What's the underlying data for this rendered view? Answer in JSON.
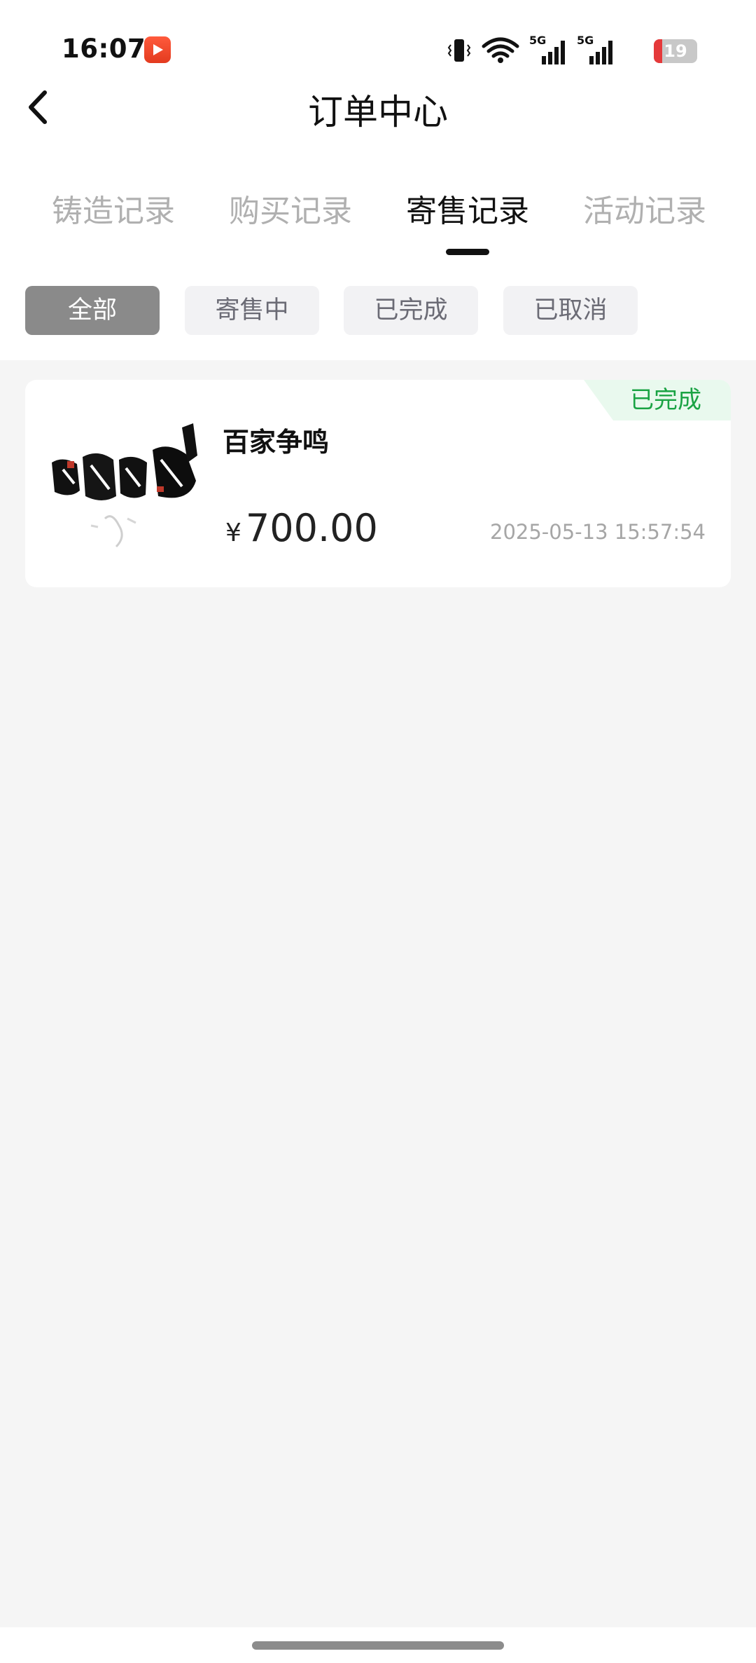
{
  "status_bar": {
    "time": "16:07",
    "app_icon": "video-play-icon",
    "icons": [
      "vibrate-icon",
      "wifi-icon",
      "signal-5g-icon",
      "signal-5g-icon"
    ],
    "network_labels": [
      "5G",
      "5G"
    ],
    "battery_level": "19",
    "battery_fraction": 0.19
  },
  "header": {
    "back_icon": "chevron-left-icon",
    "title": "订单中心"
  },
  "tabs": [
    {
      "label": "铸造记录",
      "active": false
    },
    {
      "label": "购买记录",
      "active": false
    },
    {
      "label": "寄售记录",
      "active": true
    },
    {
      "label": "活动记录",
      "active": false
    }
  ],
  "filters": [
    {
      "label": "全部",
      "active": true
    },
    {
      "label": "寄售中",
      "active": false
    },
    {
      "label": "已完成",
      "active": false
    },
    {
      "label": "已取消",
      "active": false
    }
  ],
  "orders": [
    {
      "status": "已完成",
      "name": "百家争鸣",
      "currency": "¥",
      "price": "700.00",
      "time": "2025-05-13 15:57:54",
      "thumbnail": "calligraphy-artwork-image"
    }
  ],
  "colors": {
    "page_bg": "#f5f5f5",
    "chip_active_bg": "#8a8a8a",
    "status_done_text": "#1aa344",
    "status_done_bg": "#e9f9ee",
    "battery_low": "#e5393a"
  }
}
